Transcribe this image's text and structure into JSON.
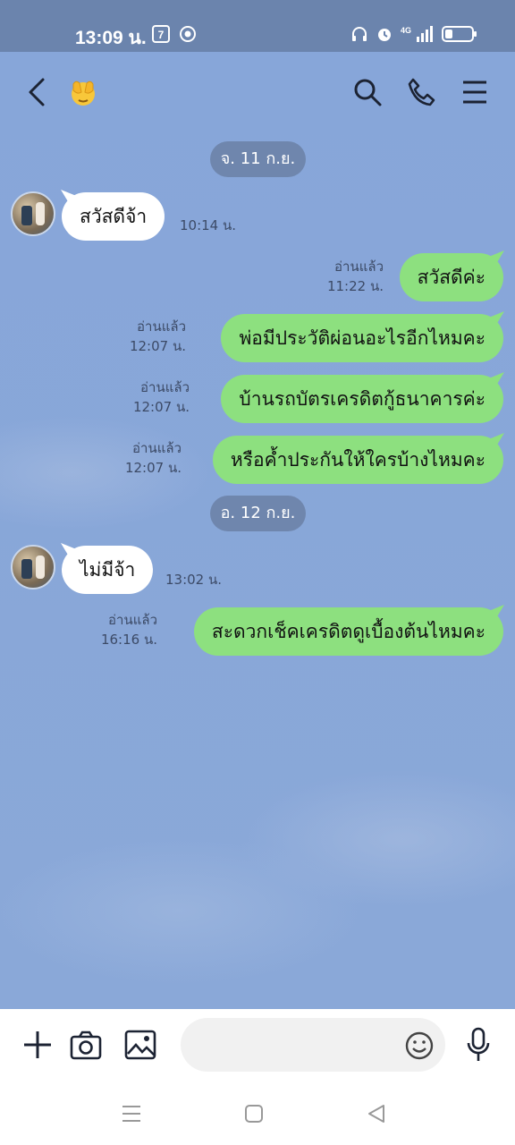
{
  "status_bar": {
    "time": "13:09 น.",
    "network": "4G",
    "battery_level": 0.3
  },
  "header": {
    "icons": [
      "back-icon",
      "hiding-face-emoji",
      "search-icon",
      "phone-icon",
      "menu-icon"
    ]
  },
  "dates": [
    "จ. 11 ก.ย.",
    "อ. 12 ก.ย."
  ],
  "messages": [
    {
      "direction": "in",
      "text": "สวัสดีจ้า",
      "time": "10:14 น."
    },
    {
      "direction": "out",
      "text": "สวัสดีค่ะ",
      "read": "อ่านแล้ว",
      "time": "11:22 น."
    },
    {
      "direction": "out",
      "text": "พ่อมีประวัติผ่อนอะไรอีกไหมคะ",
      "read": "อ่านแล้ว",
      "time": "12:07 น."
    },
    {
      "direction": "out",
      "text": "บ้านรถบัตรเครดิตกู้ธนาคารค่ะ",
      "read": "อ่านแล้ว",
      "time": "12:07 น."
    },
    {
      "direction": "out",
      "text": "หรือค้ำประกันให้ใครบ้างไหมคะ",
      "read": "อ่านแล้ว",
      "time": "12:07 น."
    },
    {
      "direction": "in",
      "text": "ไม่มีจ้า",
      "time": "13:02 น."
    },
    {
      "direction": "out",
      "text": "สะดวกเช็คเครดิตดูเบื้องต้นไหมคะ",
      "read": "อ่านแล้ว",
      "time": "16:16 น."
    }
  ],
  "composer": {
    "placeholder": "",
    "icons": [
      "plus-icon",
      "camera-icon",
      "image-icon",
      "emoji-icon",
      "microphone-icon"
    ]
  },
  "nav": {
    "icons": [
      "recent-apps-icon",
      "home-icon",
      "back-nav-icon"
    ]
  }
}
